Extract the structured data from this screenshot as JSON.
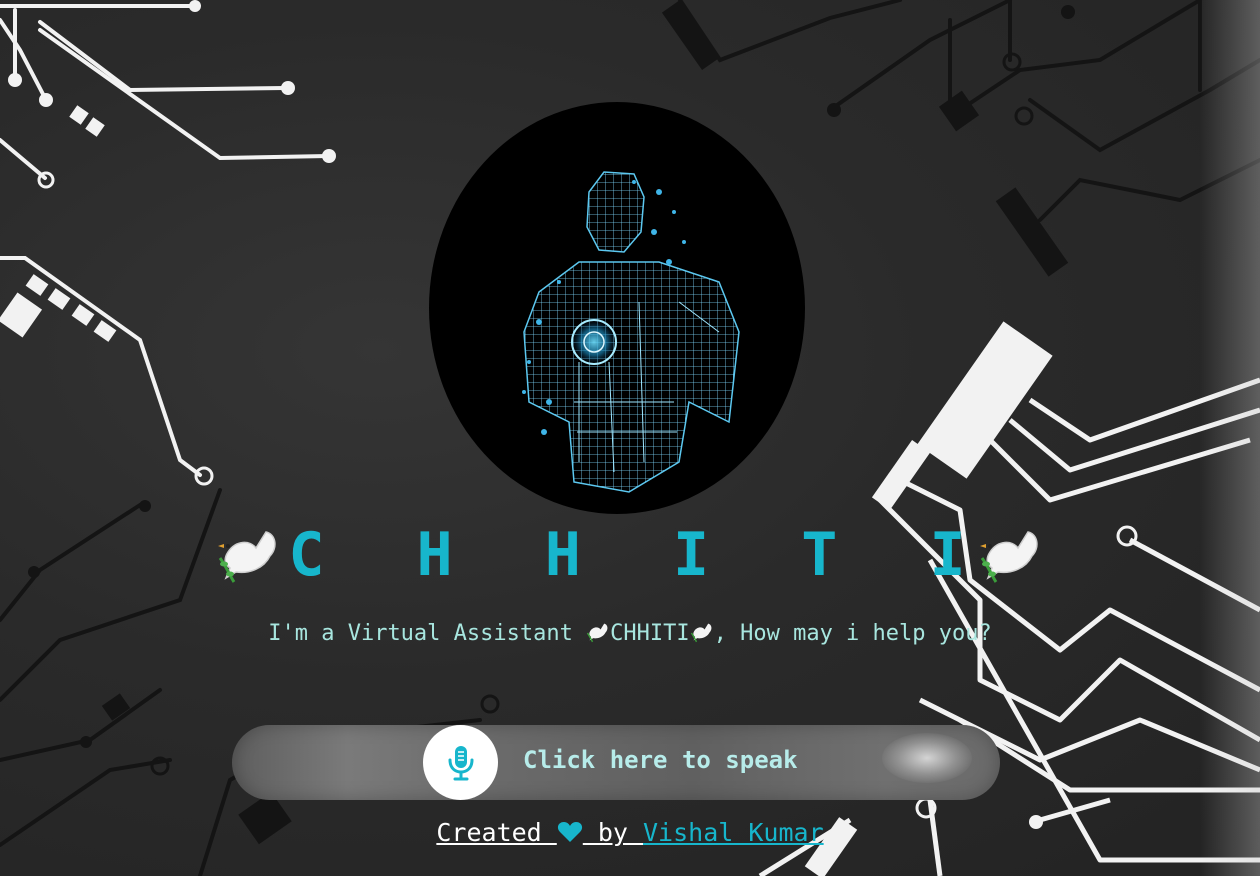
{
  "app": {
    "title": "C H H I T I",
    "subtitle_prefix": "I'm a Virtual Assistant ",
    "subtitle_name": "CHHITI",
    "subtitle_suffix": ", How may i help you?"
  },
  "speak": {
    "label": "Click here to speak",
    "icon": "microphone-icon"
  },
  "footer": {
    "created": "Created ",
    "by": " by ",
    "author": "Vishal Kumar",
    "heart_icon": "heart-icon"
  },
  "colors": {
    "accent": "#17b6cc",
    "text_light": "#a8e6df",
    "background": "#2b2b2b"
  }
}
